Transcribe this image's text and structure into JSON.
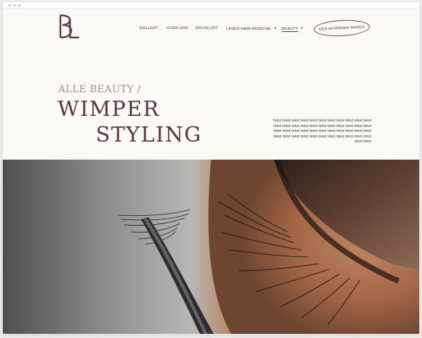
{
  "brand": {
    "logo_letters": "BL",
    "accent": "#5a373e"
  },
  "nav": {
    "items": [
      {
        "label": "GALLERY"
      },
      {
        "label": "OVER ONS"
      },
      {
        "label": "PRIJSLIJST"
      },
      {
        "label": "LASER HAIR REMOVAL"
      },
      {
        "label": "BEAUTY"
      }
    ],
    "cta_label": "EEN AFSPRAAK MAKEN"
  },
  "hero": {
    "breadcrumb": "ALLE BEAUTY /",
    "title_line1": "WIMPER",
    "title_line2": "STYLING",
    "body_text": "Tekst tekst tekst tekst tekst tekst tekst tekst tekst tekst tekst tekst tekst tekst tekst tekst tekst tekst tekst tekst tekst tekst tekst tekst tekst tekst tekst tekst tekst tekst tekst tekst tekst tekst tekst tekst tekst tekst tekst tekst tekst tekst tekst tekst tekst tekst"
  },
  "colors": {
    "background": "#fbf9f4",
    "text_dark": "#4a3a3c",
    "breadcrumb": "#9f8f90"
  }
}
